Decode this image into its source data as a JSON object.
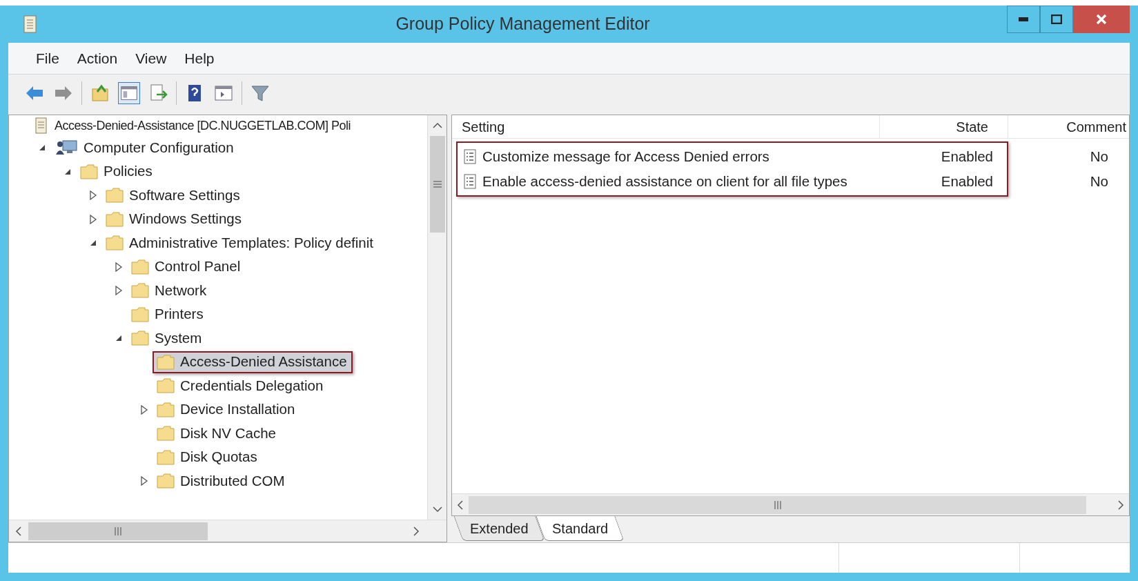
{
  "window": {
    "title": "Group Policy Management Editor"
  },
  "menu": [
    "File",
    "Action",
    "View",
    "Help"
  ],
  "tree": {
    "root": "Access-Denied-Assistance [DC.NUGGETLAB.COM] Poli",
    "items": [
      {
        "label": "Computer Configuration",
        "kind": "computer",
        "expanded": true,
        "selected": false,
        "children": [
          {
            "label": "Policies",
            "kind": "folder",
            "expanded": true,
            "selected": false,
            "children": [
              {
                "label": "Software Settings",
                "kind": "folder",
                "expanded": false,
                "selected": false
              },
              {
                "label": "Windows Settings",
                "kind": "folder",
                "expanded": false,
                "selected": false
              },
              {
                "label": "Administrative Templates: Policy definit",
                "kind": "folder",
                "expanded": true,
                "selected": false,
                "children": [
                  {
                    "label": "Control Panel",
                    "kind": "folder",
                    "expanded": false,
                    "selected": false
                  },
                  {
                    "label": "Network",
                    "kind": "folder",
                    "expanded": false,
                    "selected": false
                  },
                  {
                    "label": "Printers",
                    "kind": "folder",
                    "selected": false
                  },
                  {
                    "label": "System",
                    "kind": "folder",
                    "expanded": true,
                    "selected": false,
                    "children": [
                      {
                        "label": "Access-Denied Assistance",
                        "kind": "folder",
                        "selected": true
                      },
                      {
                        "label": "Credentials Delegation",
                        "kind": "folder",
                        "selected": false
                      },
                      {
                        "label": "Device Installation",
                        "kind": "folder",
                        "expanded": false,
                        "selected": false
                      },
                      {
                        "label": "Disk NV Cache",
                        "kind": "folder",
                        "selected": false
                      },
                      {
                        "label": "Disk Quotas",
                        "kind": "folder",
                        "selected": false
                      },
                      {
                        "label": "Distributed COM",
                        "kind": "folder",
                        "expanded": false,
                        "selected": false
                      }
                    ]
                  }
                ]
              }
            ]
          }
        ]
      }
    ]
  },
  "table": {
    "columns": [
      "Setting",
      "State",
      "Comment"
    ],
    "rows": [
      {
        "setting": "Customize message for Access Denied errors",
        "state": "Enabled",
        "comment": "No"
      },
      {
        "setting": "Enable access-denied assistance on client for all file types",
        "state": "Enabled",
        "comment": "No"
      }
    ]
  },
  "tabs": [
    {
      "label": "Extended",
      "selected": false
    },
    {
      "label": "Standard",
      "selected": true
    }
  ]
}
